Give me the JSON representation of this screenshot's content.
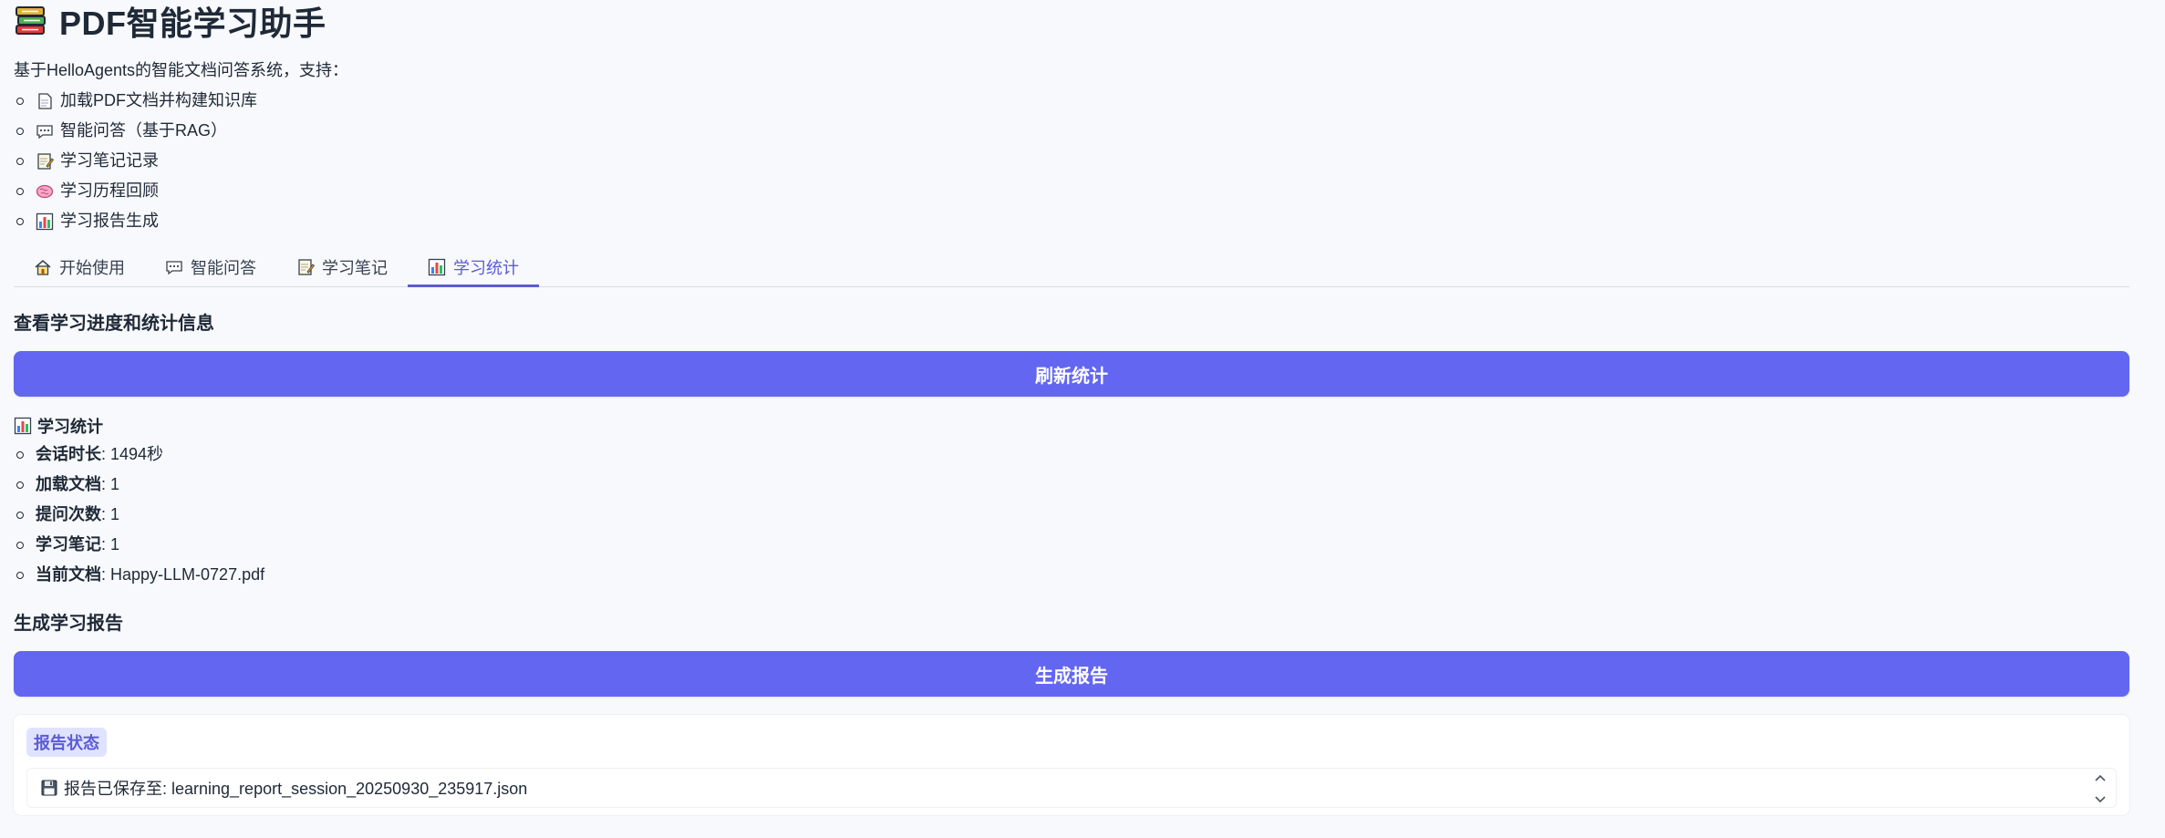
{
  "header": {
    "icon": "books-icon",
    "title": "PDF智能学习助手",
    "intro": "基于HelloAgents的智能文档问答系统，支持："
  },
  "features": [
    {
      "icon": "page-icon",
      "label": "加载PDF文档并构建知识库"
    },
    {
      "icon": "speech-bubble-icon",
      "label": "智能问答（基于RAG）"
    },
    {
      "icon": "memo-icon",
      "label": "学习笔记记录"
    },
    {
      "icon": "brain-icon",
      "label": "学习历程回顾"
    },
    {
      "icon": "bar-chart-icon",
      "label": "学习报告生成"
    }
  ],
  "tabs": [
    {
      "icon": "house-icon",
      "label": "开始使用",
      "active": false
    },
    {
      "icon": "speech-bubble-icon",
      "label": "智能问答",
      "active": false
    },
    {
      "icon": "memo-icon",
      "label": "学习笔记",
      "active": false
    },
    {
      "icon": "bar-chart-icon",
      "label": "学习统计",
      "active": true
    }
  ],
  "stats_section": {
    "heading": "查看学习进度和统计信息",
    "refresh_button": "刷新统计",
    "stats_title": "学习统计",
    "items": [
      {
        "key": "会话时长",
        "value": ": 1494秒"
      },
      {
        "key": "加载文档",
        "value": ": 1"
      },
      {
        "key": "提问次数",
        "value": ": 1"
      },
      {
        "key": "学习笔记",
        "value": ": 1"
      },
      {
        "key": "当前文档",
        "value": ": Happy-LLM-0727.pdf"
      }
    ]
  },
  "report_section": {
    "heading": "生成学习报告",
    "generate_button": "生成报告",
    "status_label": "报告状态",
    "status_text": "报告已保存至: learning_report_session_20250930_235917.json"
  },
  "colors": {
    "accent": "#6366f1",
    "tab_active": "#5b5bd6",
    "background": "#f8f9fc"
  }
}
